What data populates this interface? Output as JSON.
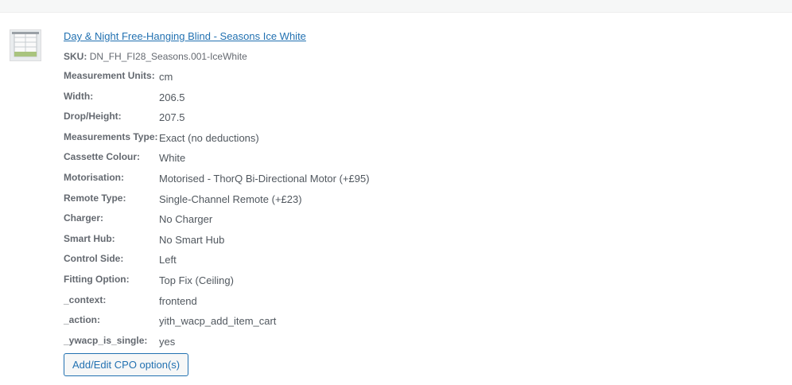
{
  "item": {
    "title": "Day & Night Free-Hanging Blind - Seasons Ice White",
    "sku_label": "SKU:",
    "sku_value": "DN_FH_FI28_Seasons.001-IceWhite",
    "thumbnail_icon": "blind-product-thumbnail"
  },
  "meta": [
    {
      "key": "Measurement Units:",
      "value": "cm"
    },
    {
      "key": "Width:",
      "value": "206.5"
    },
    {
      "key": "Drop/Height:",
      "value": "207.5"
    },
    {
      "key": "Measurements Type:",
      "value": "Exact (no deductions)"
    },
    {
      "key": "Cassette Colour:",
      "value": "White"
    },
    {
      "key": "Motorisation:",
      "value": "Motorised - ThorQ Bi-Directional Motor (+£95)"
    },
    {
      "key": "Remote Type:",
      "value": "Single-Channel Remote (+£23)"
    },
    {
      "key": "Charger:",
      "value": "No Charger"
    },
    {
      "key": "Smart Hub:",
      "value": "No Smart Hub"
    },
    {
      "key": "Control Side:",
      "value": "Left"
    },
    {
      "key": "Fitting Option:",
      "value": "Top Fix (Ceiling)"
    },
    {
      "key": "_context:",
      "value": "frontend"
    },
    {
      "key": "_action:",
      "value": "yith_wacp_add_item_cart"
    },
    {
      "key": "_ywacp_is_single:",
      "value": "yes"
    }
  ],
  "actions": {
    "cpo_button_label": "Add/Edit CPO option(s)"
  },
  "colors": {
    "link": "#2271b1",
    "label": "#646970",
    "text": "#50575e"
  }
}
